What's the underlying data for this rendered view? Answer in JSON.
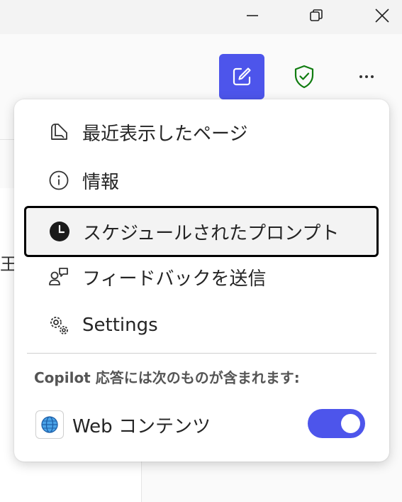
{
  "window": {
    "controls": [
      "minimize",
      "restore",
      "close"
    ]
  },
  "background": {
    "partial_text": "王砥"
  },
  "header": {
    "new_chat_icon": "compose-icon",
    "shield_icon": "shield-check-icon",
    "more_icon": "more-icon",
    "accent_color": "#4d55eb",
    "shield_color": "#107c10"
  },
  "menu": {
    "items": [
      {
        "label": "最近表示したページ",
        "icon": "book-icon"
      },
      {
        "label": "情報",
        "icon": "info-icon"
      },
      {
        "label": "スケジュールされたプロンプト",
        "icon": "clock-icon"
      },
      {
        "label": "フィードバックを送信",
        "icon": "feedback-icon"
      },
      {
        "label": "Settings",
        "icon": "gear-icon"
      }
    ],
    "section_label": "Copilot 応答には次のものが含まれます:",
    "web_content": {
      "label": "Web コンテンツ",
      "icon": "globe-icon",
      "enabled": true
    }
  }
}
